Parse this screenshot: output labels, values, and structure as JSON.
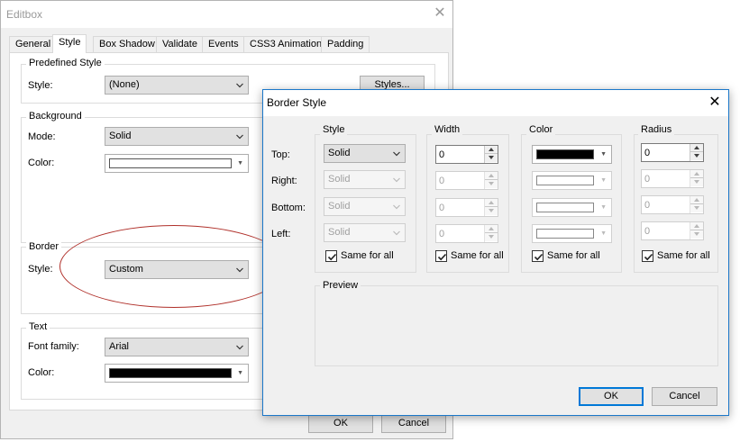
{
  "editbox": {
    "title": "Editbox",
    "tabs": [
      "General",
      "Style",
      "Box Shadow",
      "Validate",
      "Events",
      "CSS3 Animation",
      "Padding"
    ],
    "predefined": {
      "group": "Predefined Style",
      "style_label": "Style:",
      "style_value": "(None)",
      "styles_button": "Styles..."
    },
    "background": {
      "group": "Background",
      "mode_label": "Mode:",
      "mode_value": "Solid",
      "color_label": "Color:",
      "color_value": "#ffffff"
    },
    "border": {
      "group": "Border",
      "style_label": "Style:",
      "style_value": "Custom"
    },
    "text": {
      "group": "Text",
      "font_label": "Font family:",
      "font_value": "Arial",
      "color_label": "Color:",
      "color_value": "#000000"
    },
    "ok": "OK",
    "cancel": "Cancel"
  },
  "border_style": {
    "title": "Border Style",
    "row_labels": {
      "top": "Top:",
      "right": "Right:",
      "bottom": "Bottom:",
      "left": "Left:"
    },
    "style": {
      "group": "Style",
      "top": "Solid",
      "right": "Solid",
      "bottom": "Solid",
      "left": "Solid"
    },
    "width": {
      "group": "Width",
      "top": "0",
      "right": "0",
      "bottom": "0",
      "left": "0"
    },
    "color": {
      "group": "Color",
      "top": "#000000",
      "right": "#ffffff",
      "bottom": "#ffffff",
      "left": "#ffffff"
    },
    "radius": {
      "group": "Radius",
      "top": "0",
      "right": "0",
      "bottom": "0",
      "left": "0"
    },
    "same_for_all": "Same for all",
    "preview": "Preview",
    "ok": "OK",
    "cancel": "Cancel"
  }
}
